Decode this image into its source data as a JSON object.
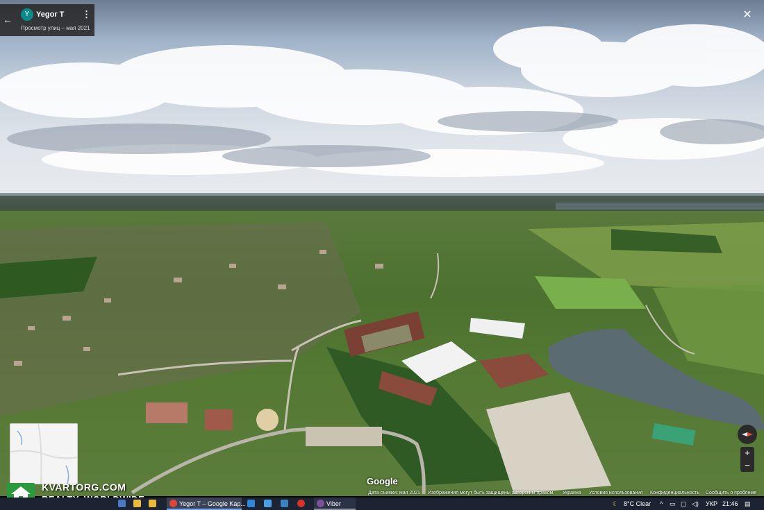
{
  "header": {
    "back_icon": "arrow-left-icon",
    "avatar_letter": "Y",
    "avatar_color": "#0c8a8a",
    "user_name": "Yegor T",
    "more_icon": "vertical-dots-icon",
    "subtitle": "Просмотр улиц – мая 2021"
  },
  "close_icon": "close-icon",
  "controls": {
    "compass_icon": "compass-icon",
    "zoom_in": "+",
    "zoom_out": "−"
  },
  "google_logo": "Google",
  "attribution": {
    "date": "Дата съемки: мая 2021",
    "notice": "Изображения могут быть защищены авторским правом.",
    "region": "Украина",
    "terms": "Условия использования",
    "privacy": "Конфиденциальность",
    "report": "Сообщить о проблеме"
  },
  "watermark": {
    "line1": "KVARTORG.COM",
    "line2": "REALTY. WORLDWIDE"
  },
  "taskbar": {
    "active_window": "Yegor T – Google Kap...",
    "viber": "Viber",
    "weather": "8°C  Clear",
    "language": "УКР",
    "time": "21:46"
  }
}
